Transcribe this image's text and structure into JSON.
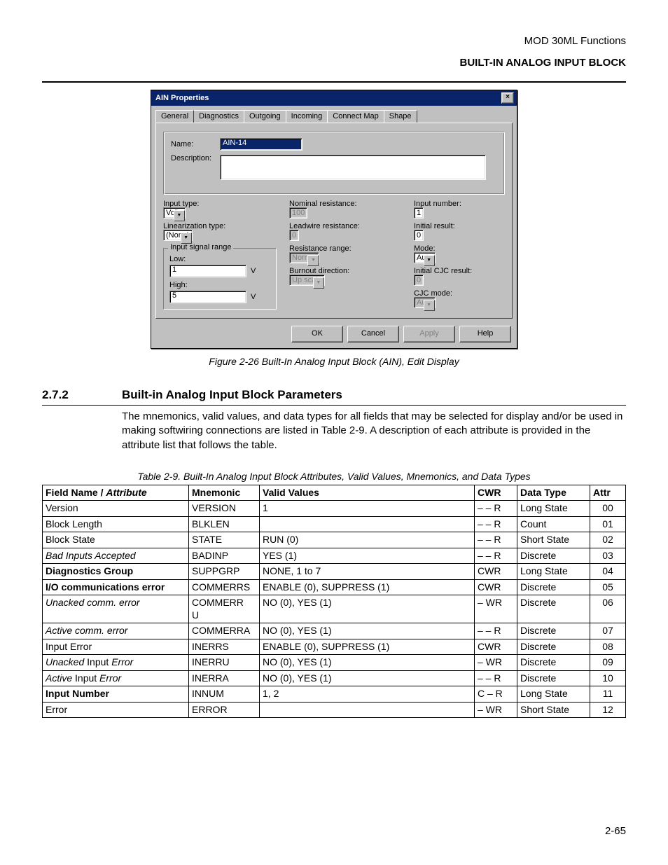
{
  "header": {
    "line1": "MOD 30ML Functions",
    "line2": "BUILT-IN ANALOG INPUT BLOCK"
  },
  "dialog": {
    "title": "AIN Properties",
    "tabs": [
      "General",
      "Diagnostics",
      "Outgoing",
      "Incoming",
      "Connect Map",
      "Shape"
    ],
    "name_label": "Name:",
    "name_value": "AIN-14",
    "desc_label": "Description:",
    "desc_value": "",
    "input_type_label": "Input type:",
    "input_type_value": "Volts",
    "lin_type_label": "Linearization type:",
    "lin_type_value": "(None)",
    "isr_legend": "Input signal range",
    "low_label": "Low:",
    "low_value": "1",
    "low_unit": "V",
    "high_label": "High:",
    "high_value": "5",
    "high_unit": "V",
    "nom_res_label": "Nominal resistance:",
    "nom_res_value": "100",
    "lead_res_label": "Leadwire resistance:",
    "lead_res_value": "0",
    "res_range_label": "Resistance range:",
    "res_range_value": "Normal",
    "burn_dir_label": "Burnout direction:",
    "burn_dir_value": "Up scale",
    "input_num_label": "Input number:",
    "input_num_value": "1",
    "init_res_label": "Initial result:",
    "init_res_value": "0",
    "mode_label": "Mode:",
    "mode_value": "Auto",
    "init_cjc_label": "Initial CJC result:",
    "init_cjc_value": "0",
    "cjc_mode_label": "CJC mode:",
    "cjc_mode_value": "Auto",
    "buttons": {
      "ok": "OK",
      "cancel": "Cancel",
      "apply": "Apply",
      "help": "Help"
    }
  },
  "figure_caption": "Figure 2-26  Built-In Analog Input Block (AIN), Edit Display",
  "section": {
    "num": "2.7.2",
    "title": "Built-in Analog Input Block Parameters",
    "body": "The mnemonics, valid values, and data types for all fields that may be selected for display and/or be used in making softwiring connections are listed in Table 2-9.  A description of each attribute is provided in the attribute list that follows the table."
  },
  "table_caption": "Table 2-9.  Built-In Analog Input Block Attributes, Valid Values, Mnemonics, and Data Types",
  "table": {
    "headers": [
      "Field Name / Attribute",
      "Mnemonic",
      "Valid Values",
      "CWR",
      "Data Type",
      "Attr"
    ],
    "rows": [
      {
        "field": "Version",
        "style": "",
        "mnem": "VERSION",
        "valid": "1",
        "cwr": "– – R",
        "dtype": "Long State",
        "attr": "00"
      },
      {
        "field": "Block Length",
        "style": "",
        "mnem": "BLKLEN",
        "valid": "",
        "cwr": "– – R",
        "dtype": "Count",
        "attr": "01"
      },
      {
        "field": "Block State",
        "style": "",
        "mnem": "STATE",
        "valid": "RUN (0)",
        "cwr": "– – R",
        "dtype": "Short State",
        "attr": "02"
      },
      {
        "field": "Bad Inputs Accepted",
        "style": "i",
        "mnem": "BADINP",
        "valid": "YES (1)",
        "cwr": "– – R",
        "dtype": "Discrete",
        "attr": "03"
      },
      {
        "field": "Diagnostics Group",
        "style": "b",
        "mnem": "SUPPGRP",
        "valid": "NONE, 1 to 7",
        "cwr": "CWR",
        "dtype": "Long State",
        "attr": "04"
      },
      {
        "field": "I/O communications error",
        "style": "b",
        "mnem": "COMMERRS",
        "valid": "ENABLE (0), SUPPRESS (1)",
        "cwr": "CWR",
        "dtype": "Discrete",
        "attr": "05"
      },
      {
        "field": "Unacked comm. error",
        "style": "i",
        "mnem": "COMMERRU",
        "valid": "NO (0), YES (1)",
        "cwr": "– WR",
        "dtype": "Discrete",
        "attr": "06"
      },
      {
        "field": "Active comm. error",
        "style": "i",
        "mnem": "COMMERRA",
        "valid": "NO (0), YES (1)",
        "cwr": "– – R",
        "dtype": "Discrete",
        "attr": "07"
      },
      {
        "field": "Input Error",
        "style": "",
        "mnem": "INERRS",
        "valid": "ENABLE (0), SUPPRESS (1)",
        "cwr": "CWR",
        "dtype": "Discrete",
        "attr": "08"
      },
      {
        "field_html": "<span class='i'>Unacked</span> Input <span class='i'>Error</span>",
        "style": "",
        "mnem": "INERRU",
        "valid": "NO (0), YES (1)",
        "cwr": "– WR",
        "dtype": "Discrete",
        "attr": "09"
      },
      {
        "field_html": "<span class='i'>Active</span> Input <span class='i'>Error</span>",
        "style": "",
        "mnem": "INERRA",
        "valid": "NO (0), YES (1)",
        "cwr": "– – R",
        "dtype": "Discrete",
        "attr": "10"
      },
      {
        "field": "Input Number",
        "style": "b",
        "mnem": "INNUM",
        "valid": "1, 2",
        "cwr": "C – R",
        "dtype": "Long State",
        "attr": "11"
      },
      {
        "field": "Error",
        "style": "",
        "mnem": "ERROR",
        "valid": "",
        "cwr": "– WR",
        "dtype": "Short State",
        "attr": "12"
      }
    ]
  },
  "page_number": "2-65"
}
